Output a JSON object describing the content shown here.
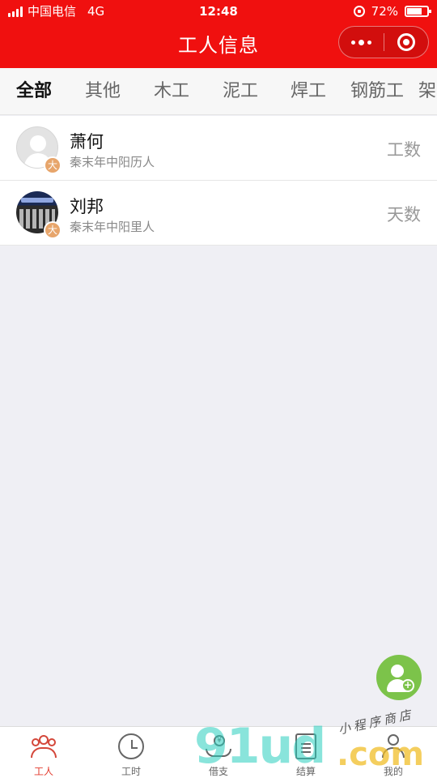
{
  "status_bar": {
    "carrier": "中国电信",
    "network": "4G",
    "time": "12:48",
    "battery": "72%"
  },
  "nav": {
    "title": "工人信息"
  },
  "tabs": [
    "全部",
    "其他",
    "木工",
    "泥工",
    "焊工",
    "钢筋工",
    "架"
  ],
  "active_tab": "全部",
  "workers": [
    {
      "name": "萧何",
      "desc": "秦末年中阳历人",
      "badge": "大",
      "metric": "工数",
      "avatar": "default-avatar"
    },
    {
      "name": "刘邦",
      "desc": "秦末年中阳里人",
      "badge": "大",
      "metric": "天数",
      "avatar": "keyboard-photo-avatar"
    }
  ],
  "tabbar": {
    "items": [
      {
        "label": "工人",
        "icon": "workers-icon",
        "active": true
      },
      {
        "label": "工时",
        "icon": "clock-icon",
        "active": false
      },
      {
        "label": "借支",
        "icon": "loan-icon",
        "active": false
      },
      {
        "label": "结算",
        "icon": "settlement-icon",
        "active": false
      },
      {
        "label": "我的",
        "icon": "profile-icon",
        "active": false
      }
    ]
  },
  "watermark": {
    "brand": "91ud",
    "domain": ".com",
    "slogan": "小程序商店"
  },
  "colors": {
    "brand_red": "#f0100f",
    "fab_green": "#7cc34a",
    "badge_orange": "#e7a56b",
    "active_tab_red": "#e33a2d"
  }
}
